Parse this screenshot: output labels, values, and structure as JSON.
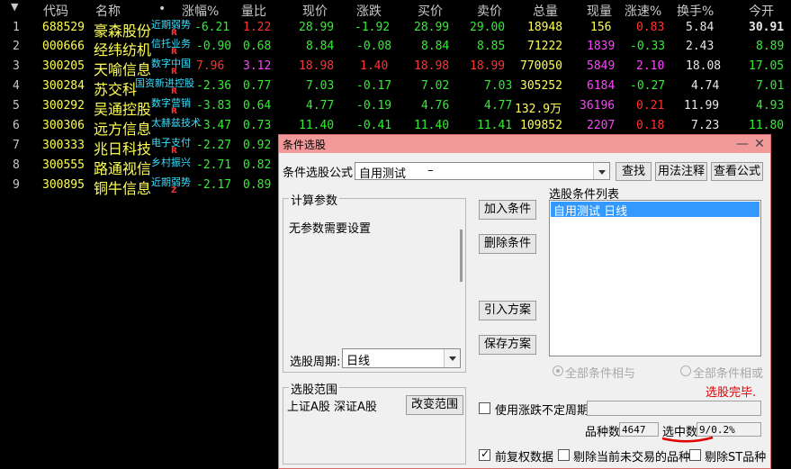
{
  "header": {
    "sort_arrow": "▼",
    "columns": [
      "代码",
      "名称",
      "•",
      "涨幅%",
      "量比",
      "现价",
      "涨跌",
      "买价",
      "卖价",
      "总量",
      "现量",
      "涨速%",
      "换手%",
      "今开"
    ]
  },
  "rows": [
    {
      "idx": "1",
      "code": "688529",
      "name": "豪森股份",
      "tag": "近期弱势",
      "flag": "R",
      "chg_pct": "-6.21",
      "vol_ratio": "1.22",
      "price": "28.99",
      "chg": "-1.92",
      "bid": "28.99",
      "ask": "29.00",
      "total": "18948",
      "cur": "156",
      "speed": "0.83",
      "turnover": "5.84",
      "open": "30.91"
    },
    {
      "idx": "2",
      "code": "000666",
      "name": "经纬纺机",
      "tag": "信托业务",
      "flag": "R",
      "chg_pct": "-0.90",
      "vol_ratio": "0.68",
      "price": "8.84",
      "chg": "-0.08",
      "bid": "8.84",
      "ask": "8.85",
      "total": "71222",
      "cur": "1839",
      "speed": "-0.33",
      "turnover": "2.43",
      "open": "8.89"
    },
    {
      "idx": "3",
      "code": "300205",
      "name": "天喻信息",
      "tag": "数字中国",
      "flag": "R",
      "chg_pct": "7.96",
      "vol_ratio": "3.12",
      "price": "18.98",
      "chg": "1.40",
      "bid": "18.98",
      "ask": "18.99",
      "total": "770050",
      "cur": "5849",
      "speed": "2.10",
      "turnover": "18.08",
      "open": "17.05"
    },
    {
      "idx": "4",
      "code": "300284",
      "name": "苏交科",
      "tag": "国资新进控股",
      "flag": "R",
      "chg_pct": "-2.36",
      "vol_ratio": "0.77",
      "price": "7.03",
      "chg": "-0.17",
      "bid": "7.02",
      "ask": "7.03",
      "total": "305252",
      "cur": "6184",
      "speed": "-0.27",
      "turnover": "4.74",
      "open": "7.01"
    },
    {
      "idx": "5",
      "code": "300292",
      "name": "吴通控股",
      "tag": "数字营销",
      "flag": "R",
      "chg_pct": "-3.83",
      "vol_ratio": "0.64",
      "price": "4.77",
      "chg": "-0.19",
      "bid": "4.76",
      "ask": "4.77",
      "total": "132.9万",
      "cur": "36196",
      "speed": "0.21",
      "turnover": "11.99",
      "open": "4.93"
    },
    {
      "idx": "6",
      "code": "300306",
      "name": "远方信息",
      "tag": "太赫兹技术",
      "flag": "",
      "chg_pct": "-3.47",
      "vol_ratio": "0.73",
      "price": "11.40",
      "chg": "-0.41",
      "bid": "11.40",
      "ask": "11.41",
      "total": "109852",
      "cur": "2207",
      "speed": "0.18",
      "turnover": "7.23",
      "open": "11.80"
    },
    {
      "idx": "7",
      "code": "300333",
      "name": "兆日科技",
      "tag": "电子支付",
      "flag": "R",
      "chg_pct": "-2.27",
      "vol_ratio": "0.92",
      "price": "",
      "chg": "",
      "bid": "",
      "ask": "",
      "total": "",
      "cur": "",
      "speed": "",
      "turnover": "",
      "open": ""
    },
    {
      "idx": "8",
      "code": "300555",
      "name": "路通视信",
      "tag": "乡村振兴",
      "flag": "",
      "chg_pct": "-2.71",
      "vol_ratio": "0.82",
      "price": "",
      "chg": "",
      "bid": "",
      "ask": "",
      "total": "",
      "cur": "",
      "speed": "",
      "turnover": "",
      "open": ""
    },
    {
      "idx": "9",
      "code": "300895",
      "name": "铜牛信息",
      "tag": "近期弱势",
      "flag": "Z",
      "chg_pct": "-2.17",
      "vol_ratio": "0.89",
      "price": "",
      "chg": "",
      "bid": "",
      "ask": "",
      "total": "",
      "cur": "",
      "speed": "",
      "turnover": "",
      "open": ""
    }
  ],
  "dialog": {
    "title": "条件选股",
    "minimize": "—",
    "close": "✕",
    "formula_label": "条件选股公式",
    "formula_value": "自用测试",
    "formula_suffix": "–",
    "find_button": "查找",
    "usage_button": "用法注释",
    "view_formula_button": "查看公式",
    "params_group": "计算参数",
    "params_note": "无参数需要设置",
    "cond_list_label": "选股条件列表",
    "cond_items": [
      "自用测试  日线"
    ],
    "add_cond": "加入条件",
    "del_cond": "删除条件",
    "import_plan": "引入方案",
    "save_plan": "保存方案",
    "period_label": "选股周期:",
    "period_value": "日线",
    "radio_and": "全部条件相与",
    "radio_or": "全部条件相或",
    "done_text": "选股完毕.",
    "range_group": "选股范围",
    "range_value": "上证A股  深证A股",
    "change_range": "改变范围",
    "use_period": "使用涨跌不定周期",
    "count_label": "品种数",
    "count_value": "4647",
    "selected_label": "选中数",
    "selected_value": "9/0.2%",
    "fq_label": "前复权数据",
    "excl_notrade": "剔除当前未交易的品种",
    "excl_st": "剔除ST品种"
  },
  "colors": {
    "up": "#ff3333",
    "down": "#33ee33",
    "code": "#ffff54",
    "tag": "#35e0ff",
    "done": "#e00000"
  }
}
